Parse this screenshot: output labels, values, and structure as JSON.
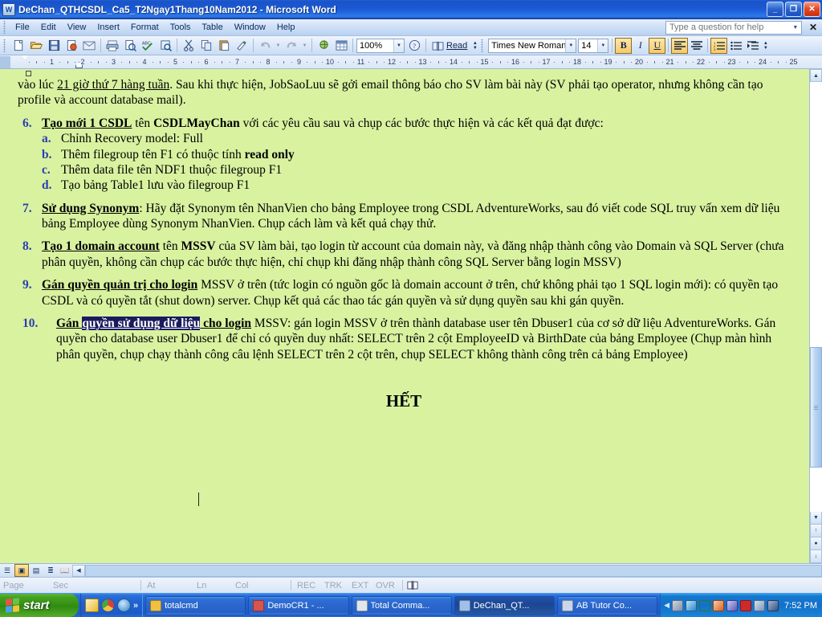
{
  "window": {
    "title": "DeChan_QTHCSDL_Ca5_T2Ngay1Thang10Nam2012 - Microsoft Word",
    "app_icon": "word-document-icon",
    "minimize_label": "_",
    "restore_label": "❐",
    "close_label": "✕"
  },
  "menubar": {
    "items": [
      {
        "label": "File"
      },
      {
        "label": "Edit"
      },
      {
        "label": "View"
      },
      {
        "label": "Insert"
      },
      {
        "label": "Format"
      },
      {
        "label": "Tools"
      },
      {
        "label": "Table"
      },
      {
        "label": "Window"
      },
      {
        "label": "Help"
      }
    ],
    "ask_box": {
      "placeholder": "Type a question for help",
      "value": ""
    },
    "close_label": "✕"
  },
  "toolbar": {
    "standard_buttons": [
      {
        "name": "new-blank-document-icon",
        "glyph": "🗋"
      },
      {
        "name": "open-icon",
        "glyph": "📂"
      },
      {
        "name": "save-icon",
        "glyph": "💾"
      },
      {
        "name": "permission-icon",
        "glyph": "🔒"
      },
      {
        "name": "mail-recipient-icon",
        "glyph": "✉"
      },
      {
        "name": "print-icon",
        "glyph": "🖨"
      },
      {
        "name": "print-preview-icon",
        "glyph": "🔍"
      },
      {
        "name": "spelling-grammar-icon",
        "glyph": "ABC"
      },
      {
        "name": "research-icon",
        "glyph": "📖"
      },
      {
        "name": "cut-icon",
        "glyph": "✂"
      },
      {
        "name": "copy-icon",
        "glyph": "📋"
      },
      {
        "name": "paste-icon",
        "glyph": "📄"
      },
      {
        "name": "format-painter-icon",
        "glyph": "🖌"
      },
      {
        "name": "undo-icon",
        "glyph": "↶"
      },
      {
        "name": "redo-icon",
        "glyph": "↷"
      },
      {
        "name": "insert-hyperlink-icon",
        "glyph": "🌐"
      },
      {
        "name": "insert-table-icon",
        "glyph": "▦"
      }
    ],
    "zoom": {
      "value": "100%",
      "name": "zoom-combo"
    },
    "help_icon": "help-question-icon",
    "read_label": "Read",
    "font_name": {
      "value": "Times New Roman",
      "name": "font-name-combo"
    },
    "font_size": {
      "value": "14",
      "name": "font-size-combo"
    },
    "bold_label": "B",
    "italic_label": "I",
    "underline_label": "U",
    "align_left_label": "☰",
    "align_center_label": "☰",
    "numbered_list_label": "≣",
    "bulleted_list_label": "≣",
    "increase_indent_label": "⇥",
    "overflow_label": "»"
  },
  "ruler": {
    "unit_numbers": [
      "1",
      "2",
      "3",
      "4",
      "5",
      "6",
      "7",
      "8",
      "9",
      "10",
      "11",
      "12",
      "13",
      "14",
      "15",
      "16",
      "17",
      "18",
      "19",
      "20",
      "21",
      "22",
      "23",
      "24",
      "25"
    ]
  },
  "document": {
    "paragraphs": [
      {
        "type": "plain",
        "runs": [
          {
            "t": "vào lúc ",
            "s": "n"
          },
          {
            "t": "21 giờ thứ 7 hàng tuần",
            "s": "u"
          },
          {
            "t": ". Sau khi thực hiện, JobSaoLuu sẽ gởi email thông báo cho SV làm bài này (SV phải tạo operator, nhưng không cần tạo profile và account database mail).",
            "s": "n"
          }
        ]
      },
      {
        "type": "item",
        "num": "6.",
        "runs": [
          {
            "t": "Tạo mới 1 CSDL",
            "s": "bu"
          },
          {
            "t": " tên ",
            "s": "n"
          },
          {
            "t": "CSDLMayChan",
            "s": "b"
          },
          {
            "t": " với các yêu cầu sau và chụp các bước thực hiện và các kết quả đạt được:",
            "s": "n"
          }
        ]
      },
      {
        "type": "subitem",
        "num": "a.",
        "runs": [
          {
            "t": "Chỉnh Recovery model: Full",
            "s": "n"
          }
        ]
      },
      {
        "type": "subitem",
        "num": "b.",
        "runs": [
          {
            "t": "Thêm filegroup tên F1 có thuộc tính ",
            "s": "n"
          },
          {
            "t": "read only",
            "s": "b"
          }
        ]
      },
      {
        "type": "subitem",
        "num": "c.",
        "runs": [
          {
            "t": "Thêm data file tên NDF1 thuộc filegroup F1",
            "s": "n"
          }
        ]
      },
      {
        "type": "subitem",
        "num": "d.",
        "runs": [
          {
            "t": "Tạo bảng Table1 lưu vào filegroup F1",
            "s": "n"
          }
        ]
      },
      {
        "type": "item",
        "num": "7.",
        "runs": [
          {
            "t": "Sử dụng Synonym",
            "s": "bu"
          },
          {
            "t": ": Hãy đặt Synonym tên NhanVien cho bảng Employee trong CSDL AdventureWorks, sau đó viết code SQL truy vấn xem dữ liệu bảng Employee dùng Synonym NhanVien. Chụp cách làm và kết quả chạy thử.",
            "s": "n"
          }
        ]
      },
      {
        "type": "item",
        "num": "8.",
        "runs": [
          {
            "t": "Tạo 1 domain account",
            "s": "bu"
          },
          {
            "t": " tên ",
            "s": "n"
          },
          {
            "t": "MSSV",
            "s": "b"
          },
          {
            "t": " của SV làm bài, tạo login từ account của domain này, và đăng nhập thành công vào Domain và SQL Server (chưa phân quyền, không cần chụp các bước thực hiện, chỉ chụp khi đăng nhập thành công SQL Server bằng login MSSV)",
            "s": "n"
          }
        ]
      },
      {
        "type": "item",
        "num": "9.",
        "runs": [
          {
            "t": "Gán quyền quản trị cho login",
            "s": "bu"
          },
          {
            "t": " MSSV ở trên (tức login có nguồn gốc là domain account ở trên, chứ không phải tạo 1 SQL login mới): có quyền tạo CSDL và có quyền tắt (shut down) server. Chụp kết quả các thao tác gán quyền và sử dụng quyền sau khi gán quyền.",
            "s": "n"
          }
        ]
      },
      {
        "type": "item",
        "num": "10.",
        "wide": true,
        "runs": [
          {
            "t": "Gán ",
            "s": "bu"
          },
          {
            "t": "quyền sử dụng dữ liệu",
            "s": "sel"
          },
          {
            "t": " cho login",
            "s": "bu"
          },
          {
            "t": " MSSV: gán login MSSV ở trên thành database user tên Dbuser1 của cơ sở dữ liệu AdventureWorks. Gán quyền cho database user Dbuser1 để chỉ có quyền duy nhất: SELECT trên 2 cột EmployeeID và BirthDate của bảng Employee (Chụp màn hình phân quyền, chụp chạy thành công câu lệnh SELECT trên 2 cột trên, chụp SELECT không thành công trên cả bảng Employee)",
            "s": "n"
          }
        ]
      }
    ],
    "footer_text": "HẾT"
  },
  "view_bar": {
    "buttons": [
      {
        "name": "normal-view-button",
        "glyph": "☰",
        "active": false
      },
      {
        "name": "web-layout-view-button",
        "glyph": "▣",
        "active": true
      },
      {
        "name": "print-layout-view-button",
        "glyph": "▤",
        "active": false
      },
      {
        "name": "outline-view-button",
        "glyph": "≣",
        "active": false
      },
      {
        "name": "reading-layout-view-button",
        "glyph": "📖",
        "active": false
      }
    ]
  },
  "statusbar": {
    "cells": [
      {
        "name": "page-indicator",
        "label": "Page"
      },
      {
        "name": "section-indicator",
        "label": "Sec"
      },
      {
        "name": "at-indicator",
        "label": "At"
      },
      {
        "name": "line-indicator",
        "label": "Ln"
      },
      {
        "name": "column-indicator",
        "label": "Col"
      },
      {
        "name": "record-macro-indicator",
        "label": "REC"
      },
      {
        "name": "track-changes-indicator",
        "label": "TRK"
      },
      {
        "name": "extend-selection-indicator",
        "label": "EXT"
      },
      {
        "name": "overtype-indicator",
        "label": "OVR"
      }
    ],
    "spelling_icon": "spelling-status-icon"
  },
  "taskbar": {
    "start_label": "start",
    "quick_launch": [
      {
        "name": "quicklaunch-notepad-icon",
        "color": "#f2c341"
      },
      {
        "name": "quicklaunch-chrome-icon",
        "color": "#d94134"
      },
      {
        "name": "quicklaunch-internet-explorer-icon",
        "color": "#3e9ae0"
      }
    ],
    "quick_launch_more": "»",
    "tasks": [
      {
        "name": "taskbar-item-totalcmd",
        "label": "totalcmd",
        "icon_color": "#f0c040",
        "active": false
      },
      {
        "name": "taskbar-item-democr1",
        "label": "DemoCR1 - ...",
        "icon_color": "#d9534f",
        "active": false
      },
      {
        "name": "taskbar-item-total-commander",
        "label": "Total Comma...",
        "icon_color": "#dfe6ee",
        "active": false
      },
      {
        "name": "taskbar-item-dechan-word",
        "label": "DeChan_QT...",
        "icon_color": "#9fc0e8",
        "active": true
      },
      {
        "name": "taskbar-item-ab-tutor",
        "label": "AB Tutor Co...",
        "icon_color": "#c8d8ea",
        "active": false
      }
    ],
    "tray_arrow": "◀",
    "tray_icons": [
      {
        "name": "tray-network-icon",
        "color": "#9aa9bd"
      },
      {
        "name": "tray-antivirus-icon",
        "color": "#5aa9d6"
      },
      {
        "name": "tray-updates-icon",
        "color": "#62b84a"
      },
      {
        "name": "tray-tool-icon",
        "color": "#e06b2a"
      },
      {
        "name": "tray-sync-icon",
        "color": "#7f7fd5"
      },
      {
        "name": "tray-unikey-icon",
        "color": "#cf2a2a"
      },
      {
        "name": "tray-volume-icon",
        "color": "#8fa6c0"
      },
      {
        "name": "tray-display-icon",
        "color": "#4a6fa5"
      }
    ],
    "clock": "7:52 PM"
  },
  "colors": {
    "page_background": "#d9f2a0",
    "selection": "#1a1a5e",
    "list_number": "#2a3fb0",
    "titlebar_blue": "#1c5ddb"
  }
}
